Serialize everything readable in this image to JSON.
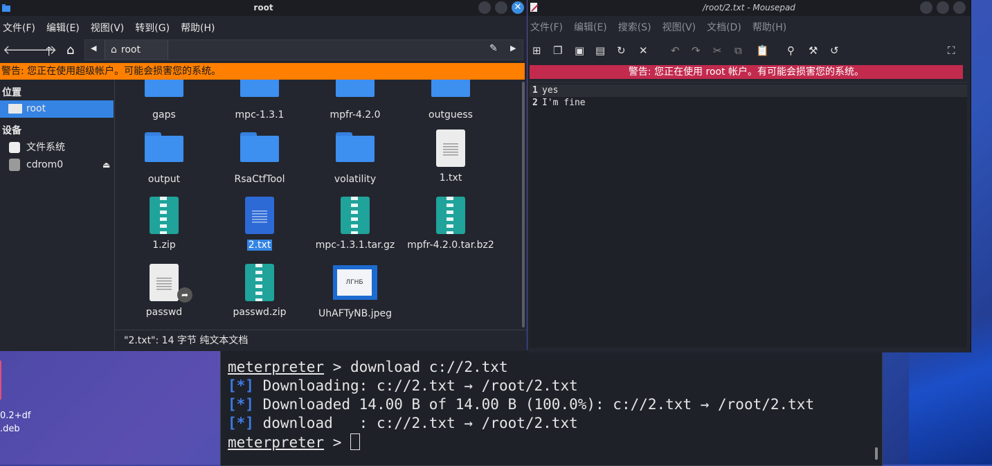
{
  "desktop": {
    "icon_line1": "0.2+df",
    "icon_line2": ".deb"
  },
  "terminal": {
    "lines": [
      {
        "prompt": "meterpreter",
        "text": " > download c://2.txt"
      },
      {
        "star": "[*]",
        "text": " Downloading: c://2.txt → /root/2.txt"
      },
      {
        "star": "[*]",
        "text": " Downloaded 14.00 B of 14.00 B (100.0%): c://2.txt → /root/2.txt"
      },
      {
        "star": "[*]",
        "text": " download   : c://2.txt → /root/2.txt"
      },
      {
        "prompt": "meterpreter",
        "text": " > "
      }
    ]
  },
  "thunar": {
    "title": "root",
    "menu": [
      "文件(F)",
      "编辑(E)",
      "视图(V)",
      "转到(G)",
      "帮助(H)"
    ],
    "path_segment": "root",
    "warning": "警告: 您正在使用超级帐户。可能会损害您的系统。",
    "sidebar": {
      "places_header": "位置",
      "root_label": "root",
      "devices_header": "设备",
      "filesystem_label": "文件系统",
      "cdrom_label": "cdrom0"
    },
    "files": [
      {
        "name": "gaps",
        "kind": "folder"
      },
      {
        "name": "mpc-1.3.1",
        "kind": "folder"
      },
      {
        "name": "mpfr-4.2.0",
        "kind": "folder"
      },
      {
        "name": "outguess",
        "kind": "folder"
      },
      {
        "name": "output",
        "kind": "folder"
      },
      {
        "name": "RsaCtfTool",
        "kind": "folder"
      },
      {
        "name": "volatility",
        "kind": "folder"
      },
      {
        "name": "1.txt",
        "kind": "text"
      },
      {
        "name": "1.zip",
        "kind": "zip"
      },
      {
        "name": "2.txt",
        "kind": "text-selected"
      },
      {
        "name": "mpc-1.3.1.tar.gz",
        "kind": "zip"
      },
      {
        "name": "mpfr-4.2.0.tar.bz2",
        "kind": "zip"
      },
      {
        "name": "passwd",
        "kind": "link"
      },
      {
        "name": "passwd.zip",
        "kind": "zip"
      },
      {
        "name": "UhAFTyNB.jpeg",
        "kind": "image"
      }
    ],
    "status": "\"2.txt\": 14 字节 纯文本文档"
  },
  "mousepad": {
    "title": "/root/2.txt - Mousepad",
    "menu": [
      "文件(F)",
      "编辑(E)",
      "搜索(S)",
      "视图(V)",
      "文档(D)",
      "帮助(H)"
    ],
    "warning": "警告: 您正在使用 root 帐户。有可能会损害您的系统。",
    "lines": [
      {
        "num": "1",
        "text": "yes"
      },
      {
        "num": "2",
        "text": "I'm fine"
      }
    ]
  }
}
